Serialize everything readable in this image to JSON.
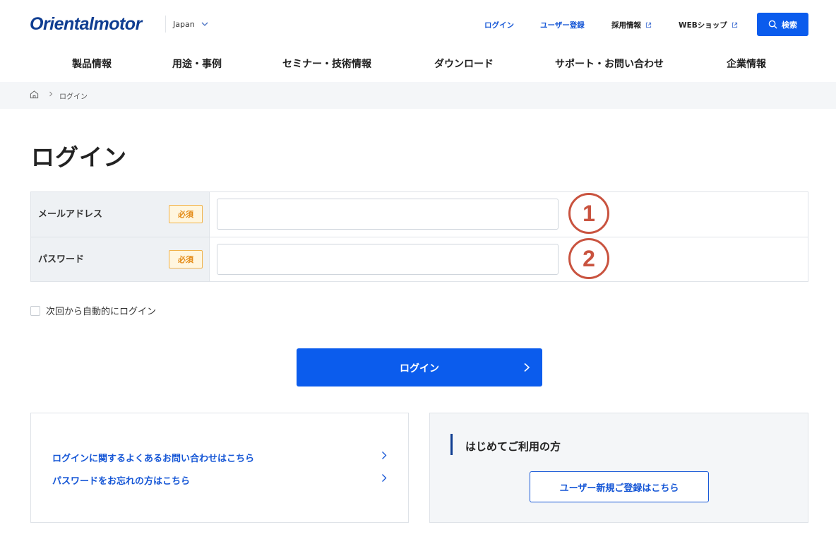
{
  "header": {
    "logo": "Orientalmotor",
    "region": "Japan",
    "util_links": [
      {
        "label": "ログイン"
      },
      {
        "label": "ユーザー登録"
      },
      {
        "label": "採用情報"
      },
      {
        "label": "WEBショップ"
      }
    ],
    "search_label": "検索",
    "nav": [
      "製品情報",
      "用途・事例",
      "セミナー・技術情報",
      "ダウンロード",
      "サポート・お問い合わせ",
      "企業情報"
    ]
  },
  "breadcrumb": {
    "current": "ログイン"
  },
  "page_title": "ログイン",
  "form": {
    "rows": [
      {
        "label": "メールアドレス",
        "required": "必須",
        "value": "",
        "marker": "1"
      },
      {
        "label": "パスワード",
        "required": "必須",
        "value": "",
        "marker": "2"
      }
    ],
    "auto_login": "次回から自動的にログイン",
    "submit_label": "ログイン"
  },
  "help": {
    "links": [
      "ログインに関するよくあるお問い合わせはこちら",
      "パスワードをお忘れの方はこちら"
    ]
  },
  "new_user": {
    "title": "はじめてご利用の方",
    "button": "ユーザー新規ご登録はこちら"
  },
  "colors": {
    "primary": "#0b5ced",
    "logo": "#0f3d91",
    "required": "#e48b16",
    "marker": "#c9533f"
  }
}
